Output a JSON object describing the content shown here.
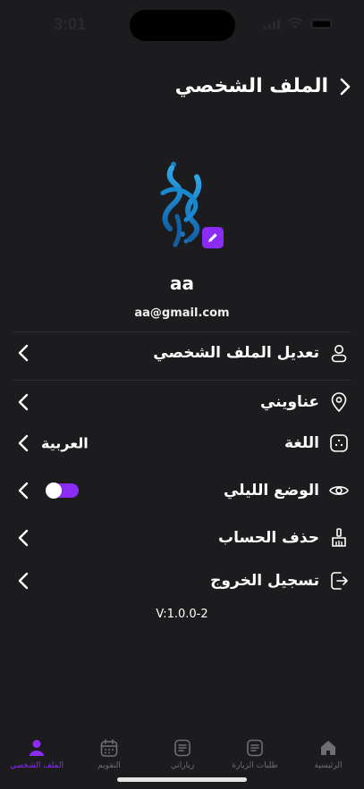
{
  "status": {
    "time": "3:01"
  },
  "header": {
    "title": "الملف الشخصي"
  },
  "profile": {
    "name": "aa",
    "email": "aa@gmail.com"
  },
  "menu": [
    {
      "label": "تعديل الملف الشخصي",
      "icon": "user-icon"
    },
    {
      "label": "عناويني",
      "icon": "location-pin-icon"
    },
    {
      "label": "اللغة",
      "icon": "language-icon",
      "value": "العربية"
    },
    {
      "label": "الوضع الليلي",
      "icon": "eye-icon",
      "toggle_on": true
    },
    {
      "label": "حذف الحساب",
      "icon": "broom-icon"
    },
    {
      "label": "تسجيل الخروج",
      "icon": "logout-icon"
    }
  ],
  "version": "V:1.0.0-2",
  "tabs": [
    {
      "label": "الرئيسية",
      "icon": "home-icon"
    },
    {
      "label": "طلبات الزيارة",
      "icon": "list-icon"
    },
    {
      "label": "زياراتي",
      "icon": "document-icon"
    },
    {
      "label": "التقويم",
      "icon": "calendar-icon"
    },
    {
      "label": "الملف الشخصي",
      "icon": "person-icon",
      "active": true
    }
  ],
  "colors": {
    "accent": "#8b2cf5",
    "background": "#1c1c1e",
    "divider": "#2c2c2f",
    "logo_blue": "#1e90d6"
  }
}
